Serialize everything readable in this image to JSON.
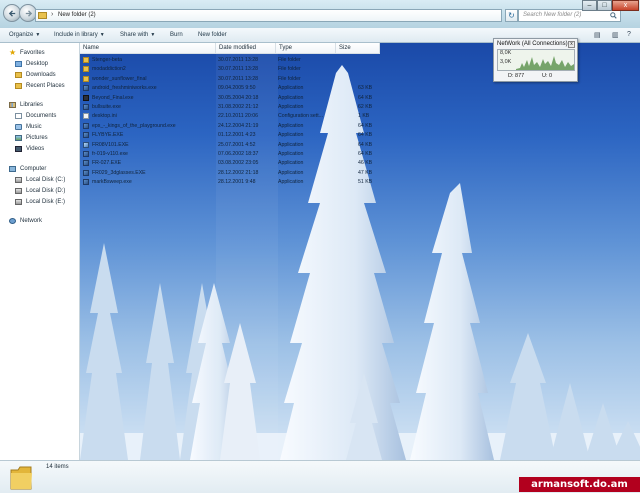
{
  "window": {
    "address_path": "New folder (2)",
    "search_placeholder": "Search New folder (2)",
    "minimize_glyph": "–",
    "maximize_glyph": "□",
    "close_glyph": "x",
    "refresh_glyph": "↻"
  },
  "toolbar": {
    "organize": "Organize",
    "include_in_library": "Include in library",
    "share_with": "Share with",
    "burn": "Burn",
    "new_folder": "New folder",
    "view_glyph": "▤",
    "help_glyph": "?"
  },
  "sidebar": {
    "favorites": "Favorites",
    "desktop": "Desktop",
    "downloads": "Downloads",
    "recent_places": "Recent Places",
    "libraries": "Libraries",
    "documents": "Documents",
    "music": "Music",
    "pictures": "Pictures",
    "videos": "Videos",
    "computer": "Computer",
    "disk_c": "Local Disk (C:)",
    "disk_d": "Local Disk (D:)",
    "disk_e": "Local Disk (E:)",
    "network": "Network"
  },
  "columns": {
    "name": "Name",
    "date": "Date modified",
    "type": "Type",
    "size": "Size"
  },
  "files": [
    {
      "name": "Stenger-beta",
      "date": "30.07.2011 13:28",
      "type": "File folder",
      "size": "",
      "icon": "folder"
    },
    {
      "name": "modaddiction2",
      "date": "30.07.2011 13:28",
      "type": "File folder",
      "size": "",
      "icon": "folder"
    },
    {
      "name": "wonder_sunflower_final",
      "date": "30.07.2011 13:28",
      "type": "File folder",
      "size": "",
      "icon": "folder"
    },
    {
      "name": "android_freshminiworks.exe",
      "date": "09.04.2005 9:50",
      "type": "Application",
      "size": "63 KB",
      "icon": "app"
    },
    {
      "name": "Beyond_Final.exe",
      "date": "30.05.2004 20:18",
      "type": "Application",
      "size": "64 KB",
      "icon": "dark"
    },
    {
      "name": "bullsuite.exe",
      "date": "31.08.2002 21:12",
      "type": "Application",
      "size": "62 KB",
      "icon": "app"
    },
    {
      "name": "desktop.ini",
      "date": "22.10.2011 20:06",
      "type": "Configuration sett...",
      "size": "1 KB",
      "icon": "cfg"
    },
    {
      "name": "eps_-_kings_of_the_playground.exe",
      "date": "24.12.2004 21:19",
      "type": "Application",
      "size": "64 KB",
      "icon": "app"
    },
    {
      "name": "FLYBYE.EXE",
      "date": "01.12.2001 4:23",
      "type": "Application",
      "size": "64 KB",
      "icon": "app"
    },
    {
      "name": "FR08V101.EXE",
      "date": "25.07.2001 4:52",
      "type": "Application",
      "size": "64 KB",
      "icon": "img"
    },
    {
      "name": "fr-019-v110.exe",
      "date": "07.06.2002 18:37",
      "type": "Application",
      "size": "64 KB",
      "icon": "app"
    },
    {
      "name": "FR-027.EXE",
      "date": "03.08.2002 23:05",
      "type": "Application",
      "size": "46 KB",
      "icon": "app"
    },
    {
      "name": "FR029_3dglasses.EXE",
      "date": "28.12.2002 21:18",
      "type": "Application",
      "size": "47 KB",
      "icon": "app"
    },
    {
      "name": "markBsweep.exe",
      "date": "28.12.2001 9:48",
      "type": "Application",
      "size": "51 KB",
      "icon": "app"
    }
  ],
  "gadget": {
    "title": "NetWork (All Connections)",
    "scale_top": "8,0K",
    "scale_mid": "3,0K",
    "download": "D: 877",
    "upload": "U: 0",
    "close_glyph": "x"
  },
  "status": {
    "item_count": "14 items"
  },
  "watermark": "armansoft.do.am",
  "colors": {
    "sky_top": "#1a49a8",
    "sky_bottom": "#d6e6f5",
    "folder": "#e8c04b",
    "accent": "#2a6a9a",
    "watermark_bg": "#b2001e"
  }
}
